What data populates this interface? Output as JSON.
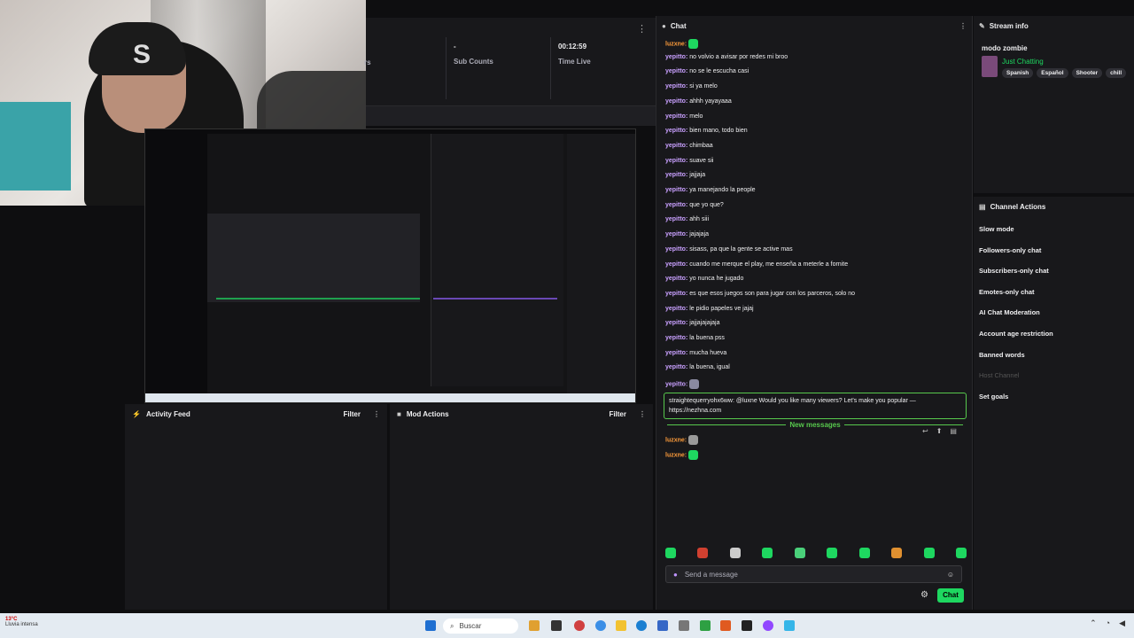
{
  "stats": {
    "items": [
      {
        "value": "-",
        "label": "Sub Counts"
      },
      {
        "value": "00:12:59",
        "label": "Time Live"
      }
    ],
    "left_partial": "rs"
  },
  "panels": {
    "activity": {
      "title": "Activity Feed",
      "filter": "Filter"
    },
    "mod": {
      "title": "Mod Actions",
      "filter": "Filter"
    }
  },
  "chat": {
    "title": "Chat",
    "messages": [
      {
        "user": "luzxne:",
        "text": "",
        "emote": "#1ed760",
        "user_color": "orange"
      },
      {
        "user": "yepitto:",
        "text": "no volvio a avisar por redes mi broo"
      },
      {
        "user": "yepitto:",
        "text": "no se le escucha casi"
      },
      {
        "user": "yepitto:",
        "text": "si ya melo"
      },
      {
        "user": "yepitto:",
        "text": "ahhh yayayaaa"
      },
      {
        "user": "yepitto:",
        "text": "melo"
      },
      {
        "user": "yepitto:",
        "text": "bien mano, todo bien"
      },
      {
        "user": "yepitto:",
        "text": "chimbaa"
      },
      {
        "user": "yepitto:",
        "text": "suave sii"
      },
      {
        "user": "yepitto:",
        "text": "jajjaja"
      },
      {
        "user": "yepitto:",
        "text": "ya manejando la people"
      },
      {
        "user": "yepitto:",
        "text": "que yo que?"
      },
      {
        "user": "yepitto:",
        "text": "ahh siii"
      },
      {
        "user": "yepitto:",
        "text": "jajajaja"
      },
      {
        "user": "yepitto:",
        "text": "sisass, pa que la gente se active mas"
      },
      {
        "user": "yepitto:",
        "text": "cuando me merque el play, me enseña a meterle a fornite"
      },
      {
        "user": "yepitto:",
        "text": "yo nunca he jugado"
      },
      {
        "user": "yepitto:",
        "text": "es que esos juegos son para jugar con los parceros, solo no"
      },
      {
        "user": "yepitto:",
        "text": "le pidio papeles ve jajaj"
      },
      {
        "user": "yepitto:",
        "text": "jajjajajajaja"
      },
      {
        "user": "yepitto:",
        "text": "la buena pss"
      },
      {
        "user": "yepitto:",
        "text": "mucha hueva"
      },
      {
        "user": "yepitto:",
        "text": "la buena, igual"
      },
      {
        "user": "yepitto:",
        "text": "",
        "emote": "#8a8aa0"
      }
    ],
    "highlight": {
      "user": "straightequerryohx6ww:",
      "text": " @luxne Would you like many viewers? Let's make you popular — https://nezhna.com"
    },
    "new_messages": "New messages",
    "after": [
      {
        "user": "luzxne:",
        "emote": "#9a9a9a"
      },
      {
        "user": "luzxne:",
        "emote": "#1ed760"
      }
    ],
    "emote_colors": [
      "#1ed760",
      "#d04030",
      "#cccccc",
      "#1ed760",
      "#4ad07a",
      "#1ed760",
      "#1ed760",
      "#e09030",
      "#1ed760",
      "#1ed760"
    ],
    "input_placeholder": "Send a message",
    "chat_button": "Chat"
  },
  "stream_info": {
    "title": "Stream info",
    "stream_title": "modo zombie",
    "category": "Just Chatting",
    "tags": [
      "Spanish",
      "Español",
      "Shooter",
      "chill"
    ]
  },
  "channel_actions": {
    "title": "Channel Actions",
    "items": [
      {
        "label": "Slow mode",
        "dim": false
      },
      {
        "label": "Followers-only chat",
        "dim": false
      },
      {
        "label": "Subscribers-only chat",
        "dim": false
      },
      {
        "label": "Emotes-only chat",
        "dim": false
      },
      {
        "label": "AI Chat Moderation",
        "dim": false
      },
      {
        "label": "Account age restriction",
        "dim": false
      },
      {
        "label": "Banned words",
        "dim": false
      },
      {
        "label": "Host Channel",
        "dim": true
      },
      {
        "label": "Set goals",
        "dim": false
      }
    ]
  },
  "taskbar": {
    "temperature": "13°C",
    "weather": "Lluvia intensa",
    "search": "Buscar"
  }
}
